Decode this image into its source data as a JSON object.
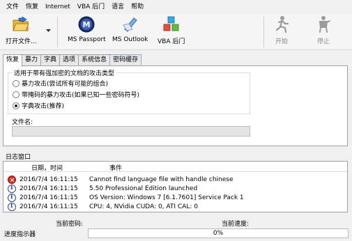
{
  "menu": [
    "文件",
    "恢复",
    "Internet",
    "VBA 后门",
    "语言",
    "帮助"
  ],
  "toolbar": {
    "open_file": "打开文件...",
    "ms_passport": "MS Passport",
    "ms_outlook": "MS Outlook",
    "vba_backdoor": "VBA 后门",
    "start": "开始",
    "stop": "停止"
  },
  "tabs": [
    "恢复",
    "暴力",
    "字典",
    "选项",
    "系统信息",
    "密码缓存"
  ],
  "attack_type": {
    "legend": "适用于带有强加密的文档的攻击类型",
    "options": [
      {
        "label": "暴力攻击(尝试所有可能的组合)",
        "checked": false
      },
      {
        "label": "带掩码的暴力攻击(如果已知一些密码符号)",
        "checked": false
      },
      {
        "label": "字典攻击(推荐)",
        "checked": true
      }
    ]
  },
  "file_name": {
    "label": "文件名:",
    "value": ""
  },
  "log": {
    "title": "日志窗口",
    "columns": {
      "datetime": "日期，时间",
      "event": "事件"
    },
    "rows": [
      {
        "icon": "error-icon",
        "datetime": "2016/7/4 16:11:15",
        "event": "Cannot find language file with handle chinese"
      },
      {
        "icon": "info-icon",
        "datetime": "2016/7/4 16:11:15",
        "event": "5.50 Professional Edition launched"
      },
      {
        "icon": "info-icon",
        "datetime": "2016/7/4 16:11:15",
        "event": "OS Version: Windows 7 [6.1.7601] Service Pack 1"
      },
      {
        "icon": "info-icon",
        "datetime": "2016/7/4 16:11:15",
        "event": "CPU: 4, NVidia CUDA: 0, ATI CAL: 0"
      }
    ]
  },
  "status": {
    "current_password": "当前密码:",
    "current_speed": "当前速度:",
    "progress_label": "进度指示器",
    "progress_text": "0%",
    "progress_value": 0
  },
  "colors": {
    "progress": "#06b025",
    "tab_border": "#3a6ea5"
  }
}
